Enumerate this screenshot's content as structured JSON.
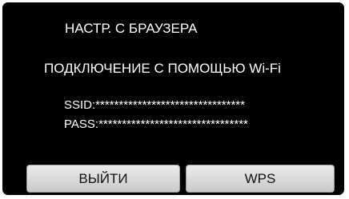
{
  "screen": {
    "title": "НАСТР. С БРАУЗЕРА",
    "message": "ПОДКЛЮЧЕНИЕ С ПОМОЩЬЮ Wi-Fi",
    "ssid_text": "SSID:********************************",
    "pass_text": "PASS:********************************"
  },
  "buttons": {
    "exit_label": "ВЫЙТИ",
    "wps_label": "WPS"
  },
  "colors": {
    "background": "#000000",
    "text": "#ffffff",
    "button": "#d9d9d9"
  }
}
